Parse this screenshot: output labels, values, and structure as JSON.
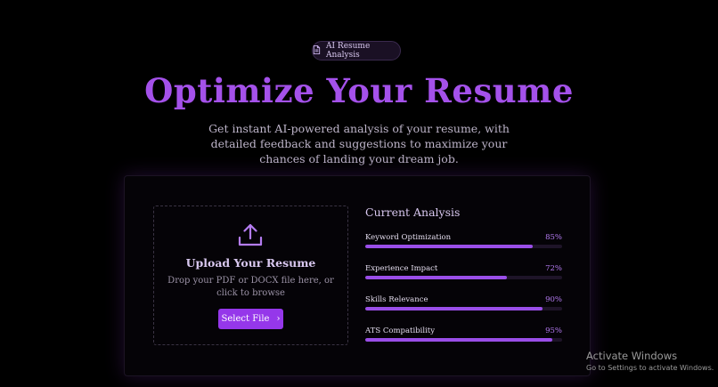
{
  "badge": {
    "label": "AI Resume Analysis",
    "icon": "document-icon"
  },
  "hero": {
    "title": "Optimize Your Resume",
    "subtitle": "Get instant AI-powered analysis of your resume, with detailed feedback and suggestions to maximize your chances of landing your dream job."
  },
  "upload": {
    "icon": "upload-icon",
    "title": "Upload Your Resume",
    "description": "Drop your PDF or DOCX file here, or click to browse",
    "button_label": "Select File",
    "button_icon": "chevron-right-icon"
  },
  "analysis": {
    "title": "Current Analysis",
    "metrics": [
      {
        "label": "Keyword Optimization",
        "value": "85%",
        "percent": 85
      },
      {
        "label": "Experience Impact",
        "value": "72%",
        "percent": 72
      },
      {
        "label": "Skills Relevance",
        "value": "90%",
        "percent": 90
      },
      {
        "label": "ATS Compatibility",
        "value": "95%",
        "percent": 95
      }
    ]
  },
  "watermark": {
    "line1": "Activate Windows",
    "line2": "Go to Settings to activate Windows."
  },
  "colors": {
    "background": "#000000",
    "accent": "#a451ea",
    "button": "#9537ea",
    "bar_fill": "#9a4ee8"
  }
}
